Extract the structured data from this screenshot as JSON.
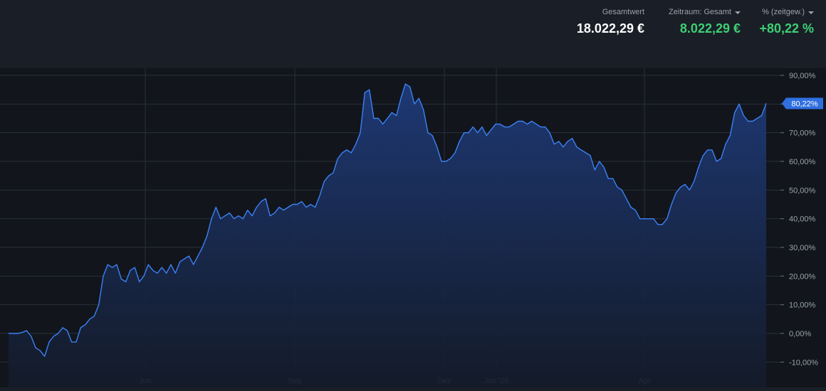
{
  "header": {
    "total": {
      "label": "Gesamtwert",
      "value": "18.022,29 €"
    },
    "period": {
      "label": "Zeitraum: Gesamt",
      "value": "8.022,29 €"
    },
    "percent": {
      "label": "% (zeitgew.)",
      "value": "+80,22 %"
    }
  },
  "colors": {
    "line": "#3b82f6",
    "fill_top": "#1e3a78",
    "grid": "#2a303a",
    "positive": "#3ecf74",
    "badge": "#2f6fe0"
  },
  "chart_data": {
    "type": "area",
    "title": "",
    "xlabel": "",
    "ylabel": "",
    "ylim": [
      -10,
      90
    ],
    "y_ticks": [
      "90,00%",
      "80,00%",
      "70,00%",
      "60,00%",
      "50,00%",
      "40,00%",
      "30,00%",
      "20,00%",
      "10,00%",
      "0,00%",
      "-10,00%"
    ],
    "x_ticks": [
      "Jun",
      "Sep",
      "Dez",
      "Jan '26",
      "Apr"
    ],
    "current_label": "80,22%",
    "grid": true,
    "series": [
      {
        "values": [
          0,
          0,
          0,
          0.3,
          1,
          -1,
          -5,
          -6,
          -8,
          -3,
          -1,
          0,
          2,
          1,
          -3,
          -3,
          2,
          3,
          5,
          6,
          10,
          20,
          24,
          23,
          24,
          19,
          18,
          22,
          23,
          18,
          20,
          24,
          22,
          21,
          23,
          21,
          24,
          21,
          25,
          26,
          27,
          24,
          27,
          30,
          34,
          40,
          44,
          40,
          41,
          42,
          40,
          41,
          40,
          43,
          41,
          44,
          46,
          47,
          41,
          42,
          44,
          43,
          44,
          45,
          45,
          46,
          44,
          45,
          44,
          48,
          53,
          55,
          56,
          61,
          63,
          64,
          63,
          66,
          70,
          84,
          85,
          75,
          75,
          73,
          75,
          77,
          76,
          82,
          87,
          86,
          80,
          82,
          78,
          70,
          69,
          65,
          60,
          60,
          61,
          63,
          67,
          70,
          70,
          72,
          70,
          72,
          69,
          71,
          73,
          73,
          72,
          72,
          73,
          74,
          74,
          73,
          74,
          73,
          72,
          72,
          70,
          66,
          67,
          65,
          67,
          68,
          65,
          64,
          63,
          62,
          57,
          60,
          58,
          54,
          54,
          51,
          50,
          47,
          44,
          43,
          40,
          40,
          40,
          40,
          38,
          38,
          40,
          45,
          49,
          51,
          52,
          50,
          53,
          58,
          62,
          64,
          64,
          60,
          61,
          66,
          69,
          77,
          80,
          76,
          74,
          74,
          75,
          76,
          80.22
        ]
      }
    ]
  }
}
